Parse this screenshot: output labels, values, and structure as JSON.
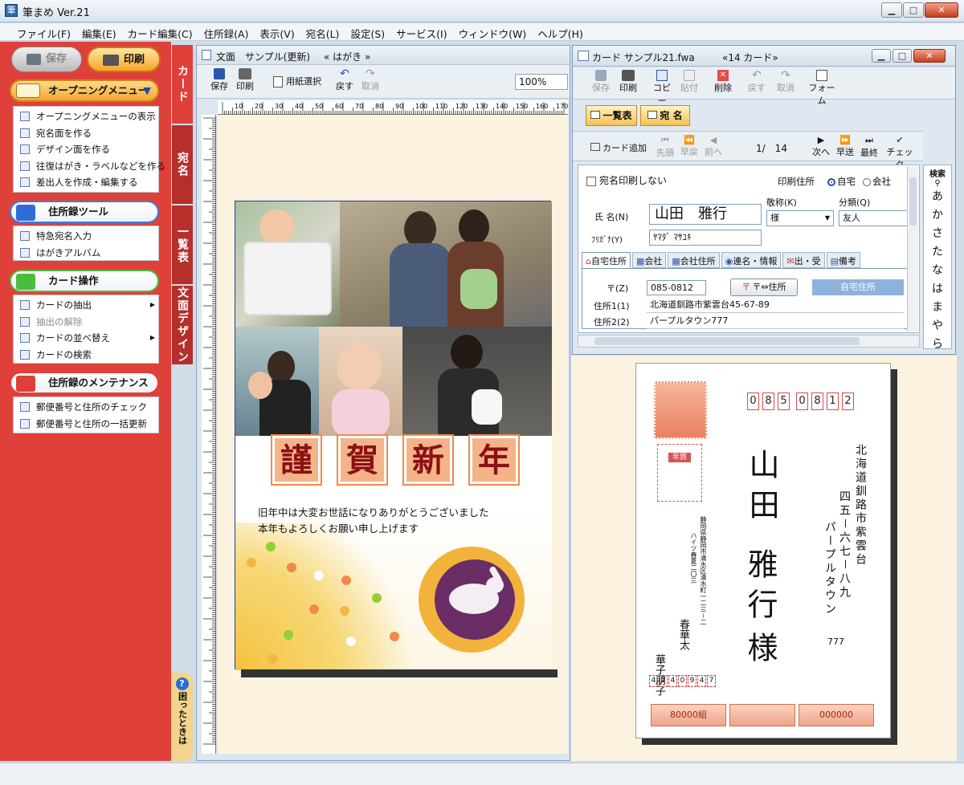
{
  "window": {
    "title": "筆まめ Ver.21",
    "icon": "app-icon"
  },
  "menu": [
    "ファイル(F)",
    "編集(E)",
    "カード編集(C)",
    "住所録(A)",
    "表示(V)",
    "宛名(L)",
    "設定(S)",
    "サービス(I)",
    "ウィンドウ(W)",
    "ヘルプ(H)"
  ],
  "sidebar": {
    "save": "保存",
    "print": "印刷",
    "opening": {
      "title": "オープニングメニュー",
      "items": [
        "オープニングメニューの表示",
        "宛名面を作る",
        "デザイン面を作る",
        "往復はがき・ラベルなどを作る",
        "差出人を作成・編集する"
      ]
    },
    "tools": {
      "title": "住所録ツール",
      "items": [
        "特急宛名入力",
        "はがきアルバム"
      ]
    },
    "card_ops": {
      "title": "カード操作",
      "items": [
        "カードの抽出",
        "抽出の解除",
        "カードの並べ替え",
        "カードの検索"
      ]
    },
    "maint": {
      "title": "住所録のメンテナンス",
      "items": [
        "郵便番号と住所のチェック",
        "郵便番号と住所の一括更新"
      ]
    }
  },
  "vtabs": [
    "カード",
    "宛名",
    "一覧表",
    "文面デザイン"
  ],
  "help_tab": "困ったときは",
  "docwin": {
    "title": "文面　サンプル(更新)",
    "subtitle": "« はがき »",
    "toolbar": {
      "save": "保存",
      "print": "印刷",
      "paper": "用紙選択",
      "undo": "戻す",
      "cancel": "取消"
    },
    "zoom": "100%",
    "ruler": [
      "10",
      "20",
      "30",
      "40",
      "50",
      "60",
      "70",
      "80",
      "90",
      "100",
      "110",
      "120",
      "130",
      "140",
      "150",
      "160",
      "170"
    ],
    "greeting": [
      "謹",
      "賀",
      "新",
      "年"
    ],
    "message": [
      "旧年中は大変お世話になりありがとうございました",
      "本年もよろしくお願い申し上げます"
    ]
  },
  "cardwin": {
    "title": "カード  サンプル21.fwa",
    "count": "«14 カード»",
    "toolbar": [
      "保存",
      "印刷",
      "コピー",
      "貼付",
      "削除",
      "戻す",
      "取消",
      "フォーム"
    ],
    "btn_list": "一覧表",
    "btn_address": "宛 名",
    "nav": {
      "add": "カード追加",
      "first": "先頭",
      "prev_fast": "早戻",
      "prev": "前へ",
      "position": "1/　14",
      "next": "次へ",
      "next_fast": "早送",
      "last": "最終",
      "check": "チェック"
    },
    "no_print": "宛名印刷しない",
    "print_address_label": "印刷住所",
    "opt_home": "自宅",
    "opt_company": "会社",
    "name_label": "氏 名(N)",
    "name_value": "山田　雅行",
    "honorific_label": "敬称(K)",
    "honorific_value": "様",
    "group_label": "分類(Q)",
    "group_value": "友人",
    "kana_label": "ﾌﾘｶﾞﾅ(Y)",
    "kana_value": "ﾔﾏﾀﾞ ﾏｻﾕｷ",
    "tabs": [
      "自宅住所",
      "会社",
      "会社住所",
      "連名・情報",
      "出・受",
      "備考"
    ],
    "zip_label": "〒(Z)",
    "zip_value": "085-0812",
    "zip_btn": "〒⇔住所",
    "home_badge": "自宅住所",
    "addr1_label": "住所1(1)",
    "addr1_value": "北海道釧路市紫雲台45-67-89",
    "addr2_label": "住所2(2)",
    "addr2_value": "パープルタウン777",
    "search_title": "検索",
    "kana_index": [
      "あ",
      "か",
      "さ",
      "た",
      "な",
      "は",
      "ま",
      "や",
      "ら"
    ]
  },
  "postcard": {
    "zip": [
      "0",
      "8",
      "5",
      "0",
      "8",
      "1",
      "2"
    ],
    "address_line1": "北海道釧路市紫雲台",
    "address_line2": "四五－六七－八九",
    "address_line3": "パープルタウン",
    "address_line4": "777",
    "name_family": "山田",
    "name_given": "雅行",
    "honorific": "様",
    "sender_address": "静岡県静岡市清水区清水町一二三－二",
    "sender_address2": "ハイツ春夏二〇三",
    "sender_name1": "春華太",
    "sender_name2": "華子朋子",
    "sender_zip": [
      "4",
      "2",
      "4",
      "0",
      "9",
      "4",
      "7"
    ],
    "stamp1": "80000組",
    "stamp2": "000000",
    "stamp_label": "年賀"
  }
}
